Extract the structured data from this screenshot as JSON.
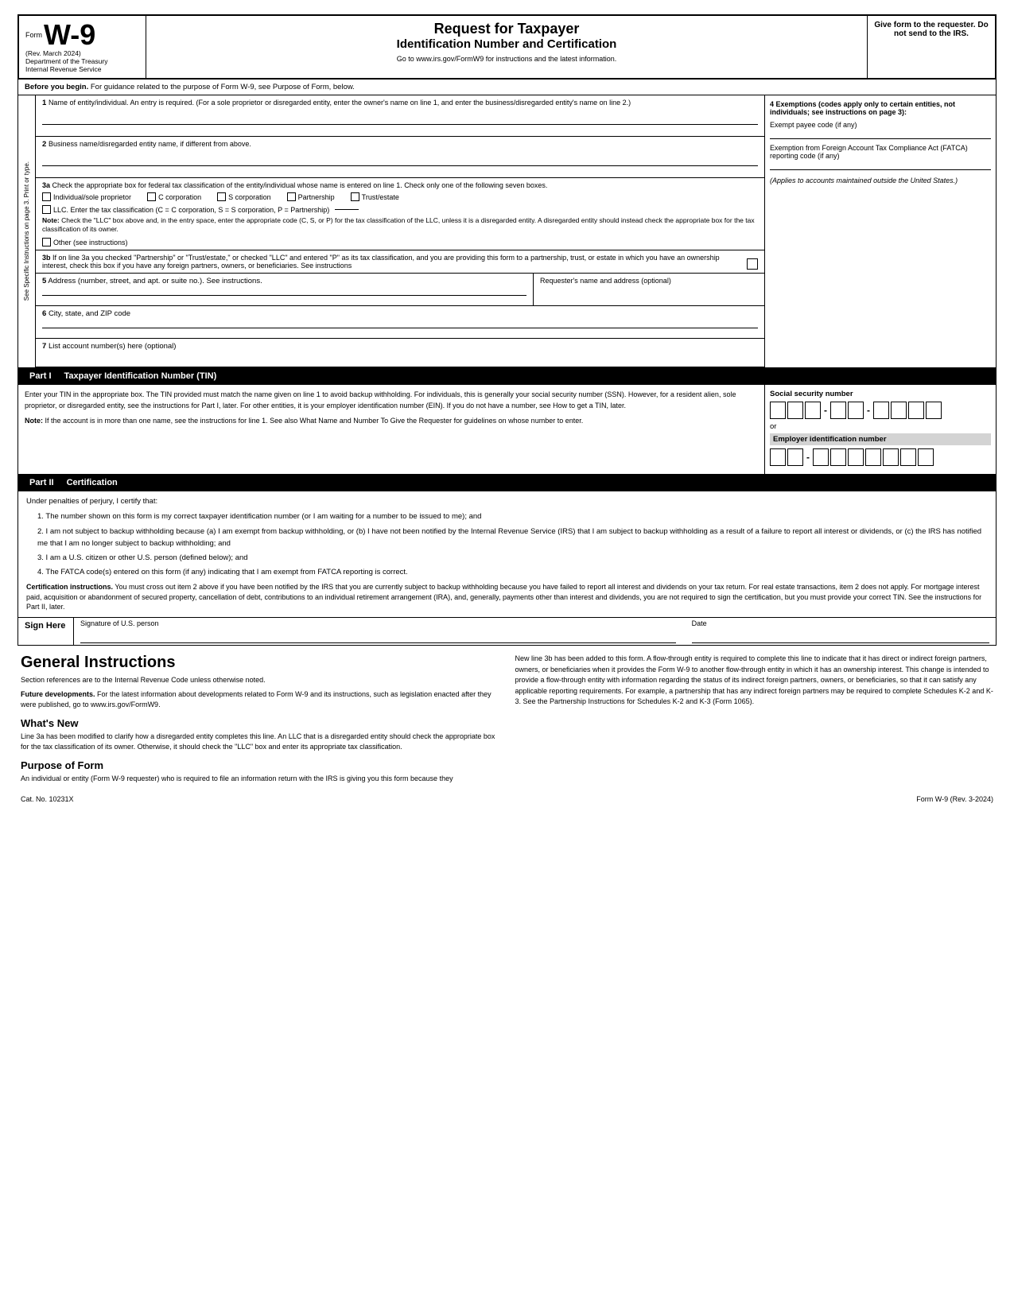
{
  "header": {
    "form_label": "Form",
    "form_number": "W-9",
    "rev_date": "(Rev. March 2024)",
    "dept": "Department of the Treasury",
    "irs": "Internal Revenue Service",
    "title1": "Request for Taxpayer",
    "title2": "Identification Number and Certification",
    "website_text": "Go to www.irs.gov/FormW9 for instructions and the latest information.",
    "give_form": "Give form to the requester. Do not send to the IRS."
  },
  "before_begin": {
    "label": "Before you begin.",
    "text": "For guidance related to the purpose of Form W-9, see Purpose of Form, below."
  },
  "fields": {
    "line1_label": "1",
    "line1_text": "Name of entity/individual. An entry is required. (For a sole proprietor or disregarded entity, enter the owner's name on line 1, and enter the business/disregarded entity's name on line 2.)",
    "line2_label": "2",
    "line2_text": "Business name/disregarded entity name, if different from above.",
    "line3a_label": "3a",
    "line3a_text": "Check the appropriate box for federal tax classification of the entity/individual whose name is entered on line 1. Check only one of the following seven boxes.",
    "cb_individual": "Individual/sole proprietor",
    "cb_ccorp": "C corporation",
    "cb_scorp": "S corporation",
    "cb_partnership": "Partnership",
    "cb_trust": "Trust/estate",
    "cb_llc": "LLC. Enter the tax classification (C = C corporation, S = S corporation, P = Partnership)",
    "note_label": "Note:",
    "note_text": "Check the \"LLC\" box above and, in the entry space, enter the appropriate code (C, S, or P) for the tax classification of the LLC, unless it is a disregarded entity. A disregarded entity should instead check the appropriate box for the tax classification of its owner.",
    "cb_other": "Other (see instructions)",
    "line3b_label": "3b",
    "line3b_text": "If on line 3a you checked \"Partnership\" or \"Trust/estate,\" or checked \"LLC\" and entered \"P\" as its tax classification, and you are providing this form to a partnership, trust, or estate in which you have an ownership interest, check this box if you have any foreign partners, owners, or beneficiaries. See instructions",
    "line5_label": "5",
    "line5_text": "Address (number, street, and apt. or suite no.). See instructions.",
    "requester_label": "Requester's name and address (optional)",
    "line6_label": "6",
    "line6_text": "City, state, and ZIP code",
    "line7_label": "7",
    "line7_text": "List account number(s) here (optional)"
  },
  "exemptions": {
    "title": "4 Exemptions (codes apply only to certain entities, not individuals; see instructions on page 3):",
    "exempt_payee": "Exempt payee code (if any)",
    "fatca_label": "Exemption from Foreign Account Tax Compliance Act (FATCA) reporting code (if any)",
    "applies_text": "(Applies to accounts maintained outside the United States.)"
  },
  "part1": {
    "label": "Part I",
    "title": "Taxpayer Identification Number (TIN)",
    "instructions": "Enter your TIN in the appropriate box. The TIN provided must match the name given on line 1 to avoid backup withholding. For individuals, this is generally your social security number (SSN). However, for a resident alien, sole proprietor, or disregarded entity, see the instructions for Part I, later. For other entities, it is your employer identification number (EIN). If you do not have a number, see How to get a TIN, later.",
    "note_label": "Note:",
    "note_text": "If the account is in more than one name, see the instructions for line 1. See also What Name and Number To Give the Requester for guidelines on whose number to enter.",
    "ssn_label": "Social security number",
    "or_text": "or",
    "ein_label": "Employer identification number"
  },
  "part2": {
    "label": "Part II",
    "title": "Certification",
    "under_penalties": "Under penalties of perjury, I certify that:",
    "cert1": "1. The number shown on this form is my correct taxpayer identification number (or I am waiting for a number to be issued to me); and",
    "cert2": "2. I am not subject to backup withholding because (a) I am exempt from backup withholding, or (b) I have not been notified by the Internal Revenue Service (IRS) that I am subject to backup withholding as a result of a failure to report all interest or dividends, or (c) the IRS has notified me that I am no longer subject to backup withholding; and",
    "cert3": "3. I am a U.S. citizen or other U.S. person (defined below); and",
    "cert4": "4. The FATCA code(s) entered on this form (if any) indicating that I am exempt from FATCA reporting is correct.",
    "cert_instructions_label": "Certification instructions.",
    "cert_instructions_text": "You must cross out item 2 above if you have been notified by the IRS that you are currently subject to backup withholding because you have failed to report all interest and dividends on your tax return. For real estate transactions, item 2 does not apply. For mortgage interest paid, acquisition or abandonment of secured property, cancellation of debt, contributions to an individual retirement arrangement (IRA), and, generally, payments other than interest and dividends, you are not required to sign the certification, but you must provide your correct TIN. See the instructions for Part II, later.",
    "sign_label": "Sign Here",
    "signature_label": "Signature of U.S. person",
    "date_label": "Date"
  },
  "general": {
    "title": "General Instructions",
    "section_ref": "Section references are to the Internal Revenue Code unless otherwise noted.",
    "future_dev_label": "Future developments.",
    "future_dev_text": "For the latest information about developments related to Form W-9 and its instructions, such as legislation enacted after they were published, go to www.irs.gov/FormW9.",
    "whats_new_title": "What's New",
    "whats_new_text": "Line 3a has been modified to clarify how a disregarded entity completes this line. An LLC that is a disregarded entity should check the appropriate box for the tax classification of its owner. Otherwise, it should check the \"LLC\" box and enter its appropriate tax classification.",
    "purpose_title": "Purpose of Form",
    "purpose_text": "An individual or entity (Form W-9 requester) who is required to file an information return with the IRS is giving you this form because they",
    "right_col_text": "New line 3b has been added to this form. A flow-through entity is required to complete this line to indicate that it has direct or indirect foreign partners, owners, or beneficiaries when it provides the Form W-9 to another flow-through entity in which it has an ownership interest. This change is intended to provide a flow-through entity with information regarding the status of its indirect foreign partners, owners, or beneficiaries, so that it can satisfy any applicable reporting requirements. For example, a partnership that has any indirect foreign partners may be required to complete Schedules K-2 and K-3. See the Partnership Instructions for Schedules K-2 and K-3 (Form 1065)."
  },
  "footer": {
    "cat_no": "Cat. No. 10231X",
    "form_label": "Form W-9 (Rev. 3-2024)"
  },
  "sidebar": {
    "text": "See Specific Instructions on page 3.  Print or type."
  }
}
